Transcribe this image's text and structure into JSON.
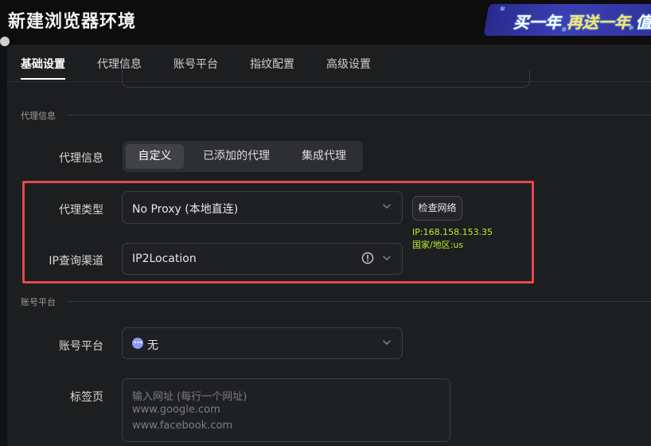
{
  "window": {
    "title": "新建浏览器环境"
  },
  "promo": {
    "part1": "买一年",
    "part2": "再送一年",
    "part3": "值"
  },
  "tabs": [
    "基础设置",
    "代理信息",
    "账号平台",
    "指纹配置",
    "高级设置"
  ],
  "proxy_section": {
    "header": "代理信息",
    "mode_label": "代理信息",
    "modes": [
      "自定义",
      "已添加的代理",
      "集成代理"
    ],
    "active_mode": "自定义",
    "type_label": "代理类型",
    "type_value": "No Proxy (本地直连)",
    "ip_channel_label": "IP查询渠道",
    "ip_channel_value": "IP2Location",
    "check_button": "检查网络",
    "ip_result": "IP:168.158.153.35",
    "region_result": "国家/地区:us"
  },
  "account_section": {
    "header": "账号平台",
    "platform_label": "账号平台",
    "platform_value": "无",
    "tabs_label": "标签页",
    "tabs_placeholder": [
      "输入网址 (每行一个网址)",
      "www.google.com",
      "www.facebook.com"
    ]
  },
  "colors": {
    "highlight_border": "#e5484d",
    "ip_text": "#b7f02b",
    "promo_bg": "#3b3fb4",
    "promo_highlight": "#ffe56b"
  }
}
